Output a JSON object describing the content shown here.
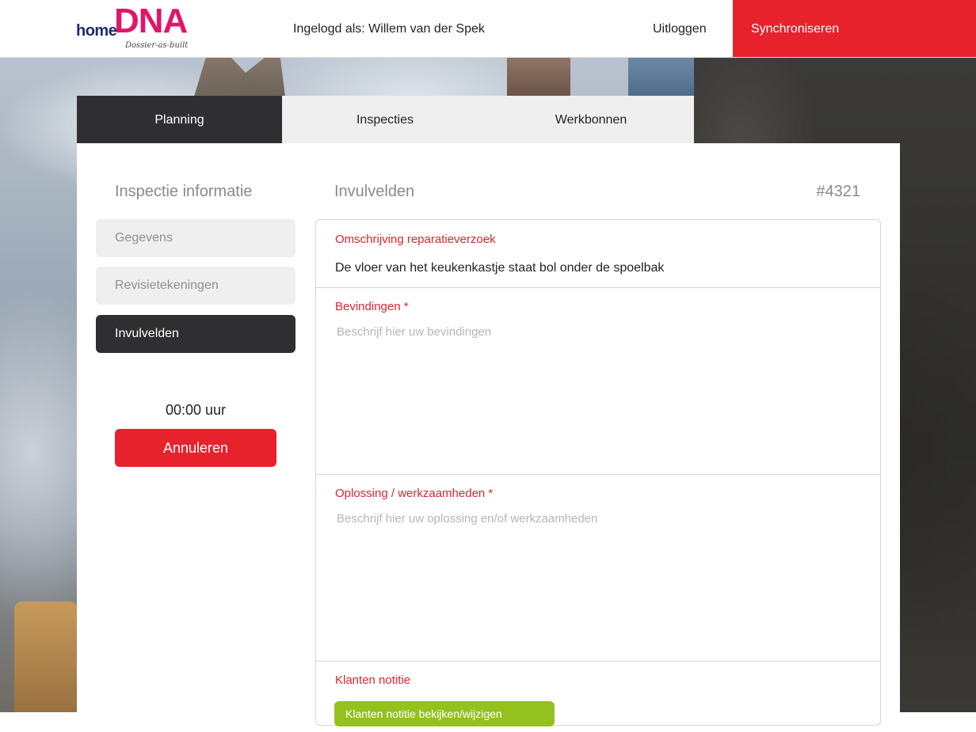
{
  "header": {
    "logo": {
      "home": "home",
      "dna": "DNA",
      "tagline": "Dossier-as-built"
    },
    "logged_in": "Ingelogd als: Willem van der Spek",
    "logout": "Uitloggen",
    "sync": "Synchroniseren"
  },
  "colors": {
    "accent_red": "#e8222d",
    "dark": "#2f2f31",
    "green": "#95c11f",
    "logo_pink": "#e0166b",
    "logo_navy": "#1e2a6e"
  },
  "tabs": [
    {
      "label": "Planning",
      "active": true
    },
    {
      "label": "Inspecties",
      "active": false
    },
    {
      "label": "Werkbonnen",
      "active": false
    }
  ],
  "sidebar": {
    "title": "Inspectie informatie",
    "items": [
      {
        "label": "Gegevens",
        "active": false
      },
      {
        "label": "Revisietekeningen",
        "active": false
      },
      {
        "label": "Invulvelden",
        "active": true
      }
    ],
    "timer": "00:00 uur",
    "cancel": "Annuleren"
  },
  "main": {
    "title": "Invulvelden",
    "id": "#4321",
    "sections": {
      "description": {
        "label": "Omschrijving reparatieverzoek",
        "value": "De vloer van het keukenkastje staat bol onder de spoelbak"
      },
      "findings": {
        "label": "Bevindingen *",
        "value": "",
        "placeholder": "Beschrijf hier uw bevindingen"
      },
      "solution": {
        "label": "Oplossing / werkzaamheden *",
        "value": "",
        "placeholder": "Beschrijf hier uw oplossing en/of werkzaamheden"
      },
      "customer_note": {
        "label": "Klanten notitie",
        "button": "Klanten notitie bekijken/wijzigen"
      }
    }
  }
}
